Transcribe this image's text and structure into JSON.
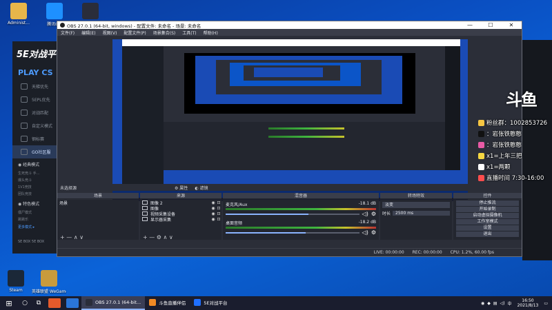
{
  "desktop": {
    "icons_top": [
      {
        "label": "Administ...",
        "color": "#e6b64a"
      },
      {
        "label": "腾讯QQ",
        "color": "#1e90ff"
      },
      {
        "label": "OBS",
        "color": "#2a2d3a"
      }
    ],
    "icons_bottom": [
      {
        "label": "Steam",
        "color": "#1b2838"
      },
      {
        "label": "英雄联盟 WeGame版",
        "color": "#c89b3c"
      }
    ]
  },
  "fivee_app": {
    "logo": "5E对战平",
    "play": "PLAY CS",
    "nav": [
      "天梯优先",
      "5EPL优先",
      "对战匹配",
      "自定义模式",
      "钢标赛",
      "GO社区服"
    ],
    "sections": [
      {
        "title": "经典模式",
        "items": [
          "生死竞斗  手…",
          "爆头竞斗",
          "1V1竞技",
          "团队竞技"
        ]
      },
      {
        "title": "特色模式",
        "items": [
          "僵尸模式",
          "跳跳乐"
        ]
      }
    ],
    "more": "更多模式 ▸",
    "footer": "SE BOX   5E BOX"
  },
  "obs": {
    "title": "OBS 27.0.1 (64-bit, windows) - 配置文件: 未命名 - 场景: 未命名",
    "menu": [
      "文件(F)",
      "编辑(E)",
      "视图(V)",
      "配置文件(P)",
      "场景集合(S)",
      "工具(T)",
      "帮助(H)"
    ],
    "no_source": "未选择源",
    "props_label": "属性",
    "filters_label": "滤镜",
    "docks": {
      "scenes": {
        "title": "场景",
        "items": [
          "场景"
        ]
      },
      "sources": {
        "title": "来源",
        "items": [
          "图像 2",
          "图像",
          "视频采集设备",
          "显示器采集"
        ]
      },
      "mixer": {
        "title": "混音器",
        "channels": [
          {
            "name": "麦克风/Aux",
            "db": "-18.1 dB",
            "level": 0.62
          },
          {
            "name": "桌面音频",
            "db": "-18.2 dB",
            "level": 0.6
          }
        ]
      },
      "transitions": {
        "title": "转场特效",
        "type": "淡变",
        "duration_label": "时长",
        "duration": "2500 ms"
      },
      "controls": {
        "title": "控件",
        "buttons": [
          "停止推流",
          "开始录制",
          "启动虚拟摄像机",
          "工作室模式",
          "设置",
          "退出"
        ]
      }
    },
    "status": {
      "live": "LIVE: 00:00:00",
      "rec": "REC: 00:00:00",
      "cpu": "CPU: 1.2%, 60.00 fps"
    }
  },
  "overlay": {
    "mark": "斗鱼",
    "lines": [
      {
        "text": "粉丝群：1002853726",
        "color": "#f5c542"
      },
      {
        "text": "：岩张铁憨憨",
        "color": "#111111"
      },
      {
        "text": "：岩张铁憨憨",
        "color": "#e85aa5"
      },
      {
        "text": "x1=上年三把",
        "color": "#f5d742"
      },
      {
        "text": "x1=两颗",
        "color": "#ffffff"
      },
      {
        "text": "直播时间 7:30-16:00",
        "color": "#ff4d4d"
      }
    ]
  },
  "taskbar": {
    "tasks": [
      {
        "label": "OBS 27.0.1 (64-bit...",
        "color": "#2a2d3a",
        "active": true
      },
      {
        "label": "斗鱼直播伴侣",
        "color": "#f08a24",
        "active": false
      },
      {
        "label": "5E对战平台",
        "color": "#1f6fff",
        "active": false
      }
    ],
    "time": "16:50",
    "date": "2021/8/13",
    "ime": "中"
  },
  "colors": {
    "accent": "#0b63d8",
    "obs_bg": "#2b2e38"
  }
}
